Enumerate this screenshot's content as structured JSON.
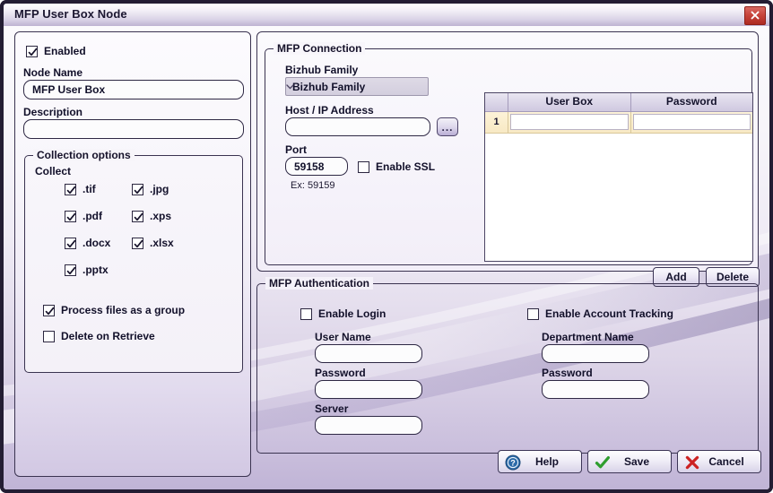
{
  "window": {
    "title": "MFP User Box Node",
    "close_icon": "close-x-icon"
  },
  "left_panel": {
    "enabled_checkbox": {
      "label": "Enabled",
      "checked": true
    },
    "node_name": {
      "label": "Node Name",
      "value": "MFP User Box",
      "placeholder": ""
    },
    "description": {
      "label": "Description",
      "value": "",
      "placeholder": ""
    },
    "collection_options": {
      "title": "Collection options",
      "collect_label": "Collect",
      "file_types": [
        {
          "label": ".tif",
          "checked": true
        },
        {
          "label": ".jpg",
          "checked": true
        },
        {
          "label": ".pdf",
          "checked": true
        },
        {
          "label": ".xps",
          "checked": true
        },
        {
          "label": ".docx",
          "checked": true
        },
        {
          "label": ".xlsx",
          "checked": true
        },
        {
          "label": ".pptx",
          "checked": true
        }
      ],
      "process_group": {
        "label": "Process files as a group",
        "checked": true
      },
      "delete_on_retrieve": {
        "label": "Delete on Retrieve",
        "checked": false
      }
    }
  },
  "connection": {
    "title": "MFP Connection",
    "family": {
      "label": "Bizhub Family",
      "selected": "Bizhub Family",
      "options": [
        "Bizhub Family"
      ]
    },
    "host": {
      "label": "Host / IP Address",
      "value": "",
      "placeholder": ""
    },
    "browse_button": {
      "label": "...",
      "icon": "ellipsis-icon"
    },
    "port": {
      "label": "Port",
      "value": "59158",
      "hint": "Ex: 59159"
    },
    "enable_ssl": {
      "label": "Enable SSL",
      "checked": false
    },
    "grid": {
      "columns": [
        "User Box",
        "Password"
      ],
      "rows": [
        {
          "num": "1",
          "user_box": "",
          "password": ""
        }
      ]
    },
    "add_button": "Add",
    "delete_button": "Delete"
  },
  "authentication": {
    "title": "MFP Authentication",
    "enable_login": {
      "label": "Enable Login",
      "checked": false
    },
    "user_name": {
      "label": "User Name",
      "value": ""
    },
    "login_password": {
      "label": "Password",
      "value": ""
    },
    "server": {
      "label": "Server",
      "value": ""
    },
    "enable_account_tracking": {
      "label": "Enable Account Tracking",
      "checked": false
    },
    "department_name": {
      "label": "Department Name",
      "value": ""
    },
    "dept_password": {
      "label": "Password",
      "value": ""
    }
  },
  "footer": {
    "help": {
      "label": "Help",
      "icon": "help-question-icon"
    },
    "save": {
      "label": "Save",
      "icon": "green-check-icon"
    },
    "cancel": {
      "label": "Cancel",
      "icon": "red-x-icon"
    }
  },
  "colors": {
    "title_bar_accent": "#bdb2d2",
    "window_border": "#231d33",
    "close_button": "#c8453c",
    "selected_row": "#f8e9c4",
    "save_icon": "#2f9e2f",
    "cancel_icon": "#cc2222",
    "help_icon": "#2b6aa8"
  }
}
